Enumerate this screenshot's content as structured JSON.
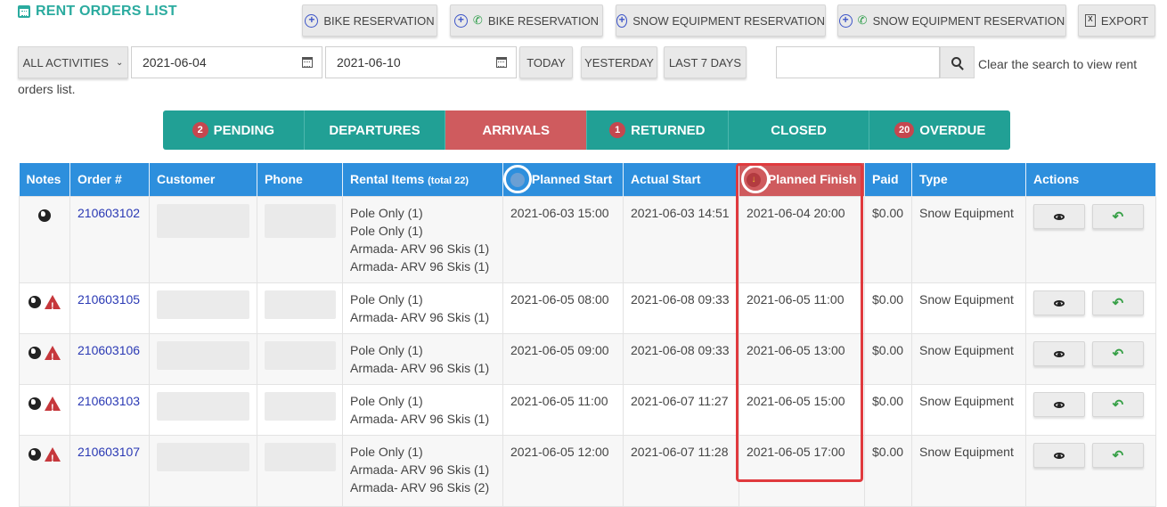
{
  "header": {
    "title": "RENT ORDERS LIST",
    "title_icon": "calendar-icon"
  },
  "actions": [
    {
      "label": "BIKE RESERVATION",
      "icons": [
        "plus-circle-icon"
      ]
    },
    {
      "label": "BIKE RESERVATION",
      "icons": [
        "plus-circle-icon",
        "phone-icon"
      ]
    },
    {
      "label": "SNOW EQUIPMENT RESERVATION",
      "icons": [
        "plus-circle-icon"
      ]
    },
    {
      "label": "SNOW EQUIPMENT RESERVATION",
      "icons": [
        "plus-circle-icon",
        "phone-icon"
      ]
    },
    {
      "label": "EXPORT",
      "icons": [
        "excel-file-icon"
      ]
    }
  ],
  "filters": {
    "activity": "ALL ACTIVITIES",
    "date_from": "2021-06-04",
    "date_to": "2021-06-10",
    "quick": [
      "TODAY",
      "YESTERDAY",
      "LAST 7 DAYS"
    ],
    "search_value": "",
    "search_hint": "Clear the search to view rent orders list."
  },
  "tabs": [
    {
      "label": "PENDING",
      "badge": "2",
      "active": false
    },
    {
      "label": "DEPARTURES",
      "badge": "",
      "active": false
    },
    {
      "label": "ARRIVALS",
      "badge": "",
      "active": true
    },
    {
      "label": "RETURNED",
      "badge": "1",
      "active": false
    },
    {
      "label": "CLOSED",
      "badge": "",
      "active": false
    },
    {
      "label": "OVERDUE",
      "badge": "20",
      "active": false
    }
  ],
  "table": {
    "columns": {
      "notes": "Notes",
      "order": "Order #",
      "customer": "Customer",
      "phone": "Phone",
      "items": "Rental Items",
      "items_total": "(total 22)",
      "planned_start": "Planned Start",
      "actual_start": "Actual Start",
      "planned_finish": "Planned Finish",
      "paid": "Paid",
      "type": "Type",
      "actions": "Actions"
    },
    "rows": [
      {
        "order": "210603102",
        "items": [
          "Pole Only (1)",
          "Pole Only (1)",
          "Armada- ARV 96 Skis (1)",
          "Armada- ARV 96 Skis (1)"
        ],
        "planned_start": "2021-06-03 15:00",
        "actual_start": "2021-06-03 14:51",
        "planned_finish": "2021-06-04 20:00",
        "paid": "$0.00",
        "type": "Snow Equipment",
        "note_icons": [
          "globe-icon"
        ]
      },
      {
        "order": "210603105",
        "items": [
          "Pole Only (1)",
          "Armada- ARV 96 Skis (1)"
        ],
        "planned_start": "2021-06-05 08:00",
        "actual_start": "2021-06-08 09:33",
        "planned_finish": "2021-06-05 11:00",
        "paid": "$0.00",
        "type": "Snow Equipment",
        "note_icons": [
          "globe-icon",
          "warning-icon"
        ]
      },
      {
        "order": "210603106",
        "items": [
          "Pole Only (1)",
          "Armada- ARV 96 Skis (1)"
        ],
        "planned_start": "2021-06-05 09:00",
        "actual_start": "2021-06-08 09:33",
        "planned_finish": "2021-06-05 13:00",
        "paid": "$0.00",
        "type": "Snow Equipment",
        "note_icons": [
          "globe-icon",
          "warning-icon"
        ]
      },
      {
        "order": "210603103",
        "items": [
          "Pole Only (1)",
          "Armada- ARV 96 Skis (1)"
        ],
        "planned_start": "2021-06-05 11:00",
        "actual_start": "2021-06-07 11:27",
        "planned_finish": "2021-06-05 15:00",
        "paid": "$0.00",
        "type": "Snow Equipment",
        "note_icons": [
          "globe-icon",
          "warning-icon"
        ]
      },
      {
        "order": "210603107",
        "items": [
          "Pole Only (1)",
          "Armada- ARV 96 Skis (1)",
          "Armada- ARV 96 Skis (2)"
        ],
        "planned_start": "2021-06-05 12:00",
        "actual_start": "2021-06-07 11:28",
        "planned_finish": "2021-06-05 17:00",
        "paid": "$0.00",
        "type": "Snow Equipment",
        "note_icons": [
          "globe-icon",
          "warning-icon"
        ]
      }
    ]
  },
  "colors": {
    "teal_tab": "#21a095",
    "active_tab": "#cf5b5e",
    "header_blue": "#2d8fdd",
    "highlight_red": "#e03a3e",
    "link_blue": "#2a39b4"
  }
}
